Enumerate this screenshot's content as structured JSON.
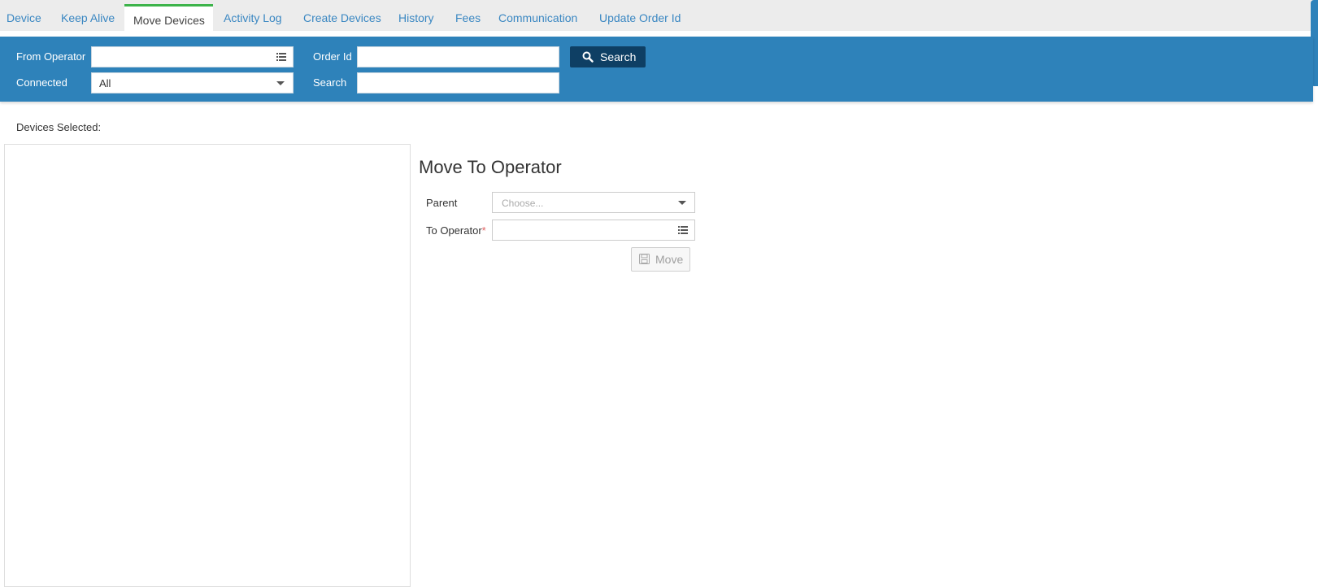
{
  "tabs": [
    {
      "label": "Device",
      "active": false
    },
    {
      "label": "Keep Alive",
      "active": false
    },
    {
      "label": "Move Devices",
      "active": true
    },
    {
      "label": "Activity Log",
      "active": false
    },
    {
      "label": "Create Devices",
      "active": false
    },
    {
      "label": "History",
      "active": false
    },
    {
      "label": "Fees",
      "active": false
    },
    {
      "label": "Communication",
      "active": false
    },
    {
      "label": "Update Order Id",
      "active": false
    }
  ],
  "filters": {
    "from_operator_label": "From Operator",
    "from_operator_value": "",
    "connected_label": "Connected",
    "connected_value": "All",
    "order_id_label": "Order Id",
    "order_id_value": "",
    "search_label": "Search",
    "search_value": "",
    "search_button": "Search"
  },
  "devices_selected_label": "Devices Selected:",
  "move_panel": {
    "title": "Move To Operator",
    "parent_label": "Parent",
    "parent_placeholder": "Choose...",
    "to_operator_label": "To Operator",
    "required_mark": "*",
    "to_operator_value": "",
    "move_button": "Move"
  },
  "colors": {
    "panel_blue": "#2e82ba",
    "search_button": "#0e3f64",
    "tab_link": "#3a87c2",
    "active_tab_accent": "#3cb34a"
  }
}
